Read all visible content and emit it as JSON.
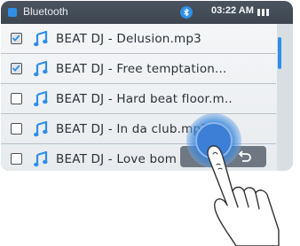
{
  "status_bar": {
    "title": "Bluetooth",
    "time": "03:22 AM",
    "bluetooth_icon": "bluetooth-icon",
    "battery_icon": "battery-icon"
  },
  "tracks": [
    {
      "label": "BEAT DJ - Delusion.mp3",
      "checked": true
    },
    {
      "label": "BEAT DJ - Free temptation...",
      "checked": true
    },
    {
      "label": "BEAT DJ - Hard beat floor.m..",
      "checked": false
    },
    {
      "label": "BEAT DJ - In da club.mp3",
      "checked": false
    },
    {
      "label": "BEAT DJ - Love bom",
      "checked": false
    }
  ],
  "icons": {
    "track": "music-note-icon",
    "return": "return-icon",
    "touch": "touch-indicator",
    "hand": "hand-icon"
  },
  "colors": {
    "accent": "#2f8fe8",
    "status_bar": "#434c56",
    "list_bg": "#f0f2f4",
    "text": "#2b3138"
  }
}
